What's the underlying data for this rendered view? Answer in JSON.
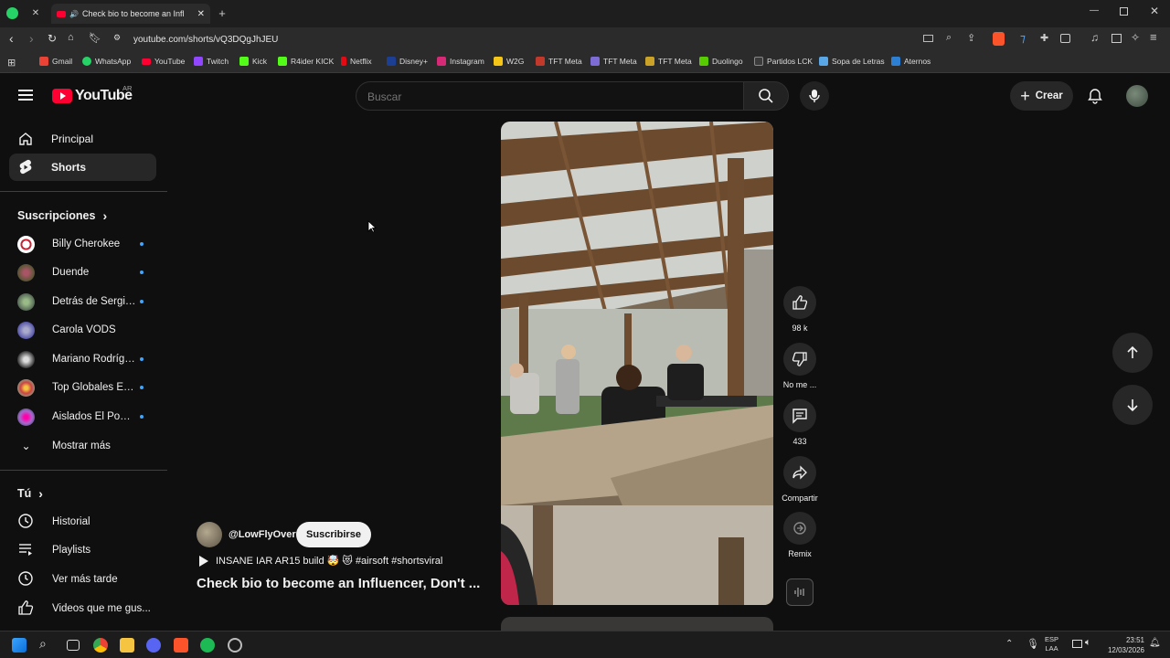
{
  "browser": {
    "tab_title": "Check bio to become an Influen",
    "url": "youtube.com/shorts/vQ3DQgJhJEU",
    "bookmarks": [
      "Gmail",
      "WhatsApp",
      "YouTube",
      "Twitch",
      "Kick",
      "R4ider KICK",
      "Netflix",
      "Disney+",
      "Instagram",
      "W2G",
      "TFT Meta",
      "TFT Meta",
      "TFT Meta",
      "Duolingo",
      "Partidos LCK",
      "Sopa de Letras",
      "Aternos"
    ]
  },
  "yt": {
    "logo_text": "YouTube",
    "region": "AR",
    "search_placeholder": "Buscar",
    "create_label": "Crear"
  },
  "sidebar": {
    "home": "Principal",
    "shorts": "Shorts",
    "subs_title": "Suscripciones",
    "subs": [
      {
        "name": "Billy Cherokee",
        "dot": true
      },
      {
        "name": "Duende",
        "dot": true
      },
      {
        "name": "Detrás de Sergio ...",
        "dot": true
      },
      {
        "name": "Carola VODS",
        "dot": false
      },
      {
        "name": "Mariano Rodrígu...",
        "dot": true
      },
      {
        "name": "Top Globales Ext...",
        "dot": true
      },
      {
        "name": "Aislados El Podc...",
        "dot": true
      }
    ],
    "show_more": "Mostrar más",
    "you_title": "Tú",
    "you_items": [
      "Historial",
      "Playlists",
      "Ver más tarde",
      "Videos que me gus..."
    ]
  },
  "short": {
    "channel": "@LowFlyOver",
    "subscribe": "Suscribirse",
    "music_line": "INSANE IAR AR15 build 🤯 😻 #airsoft #shortsviral",
    "title": "Check bio to become an Influencer, Don't ..."
  },
  "actions": {
    "likes": "98 k",
    "dislike": "No me ...",
    "comments": "433",
    "share": "Compartir",
    "remix": "Remix"
  },
  "taskbar": {
    "lang": "ESP",
    "lang2": "LAA",
    "time": "23:51",
    "date": "12/03/2026"
  },
  "colors": {
    "bg": "#0f0f0f",
    "yt_red": "#ff0033",
    "accent_blue": "#3ea6ff"
  }
}
